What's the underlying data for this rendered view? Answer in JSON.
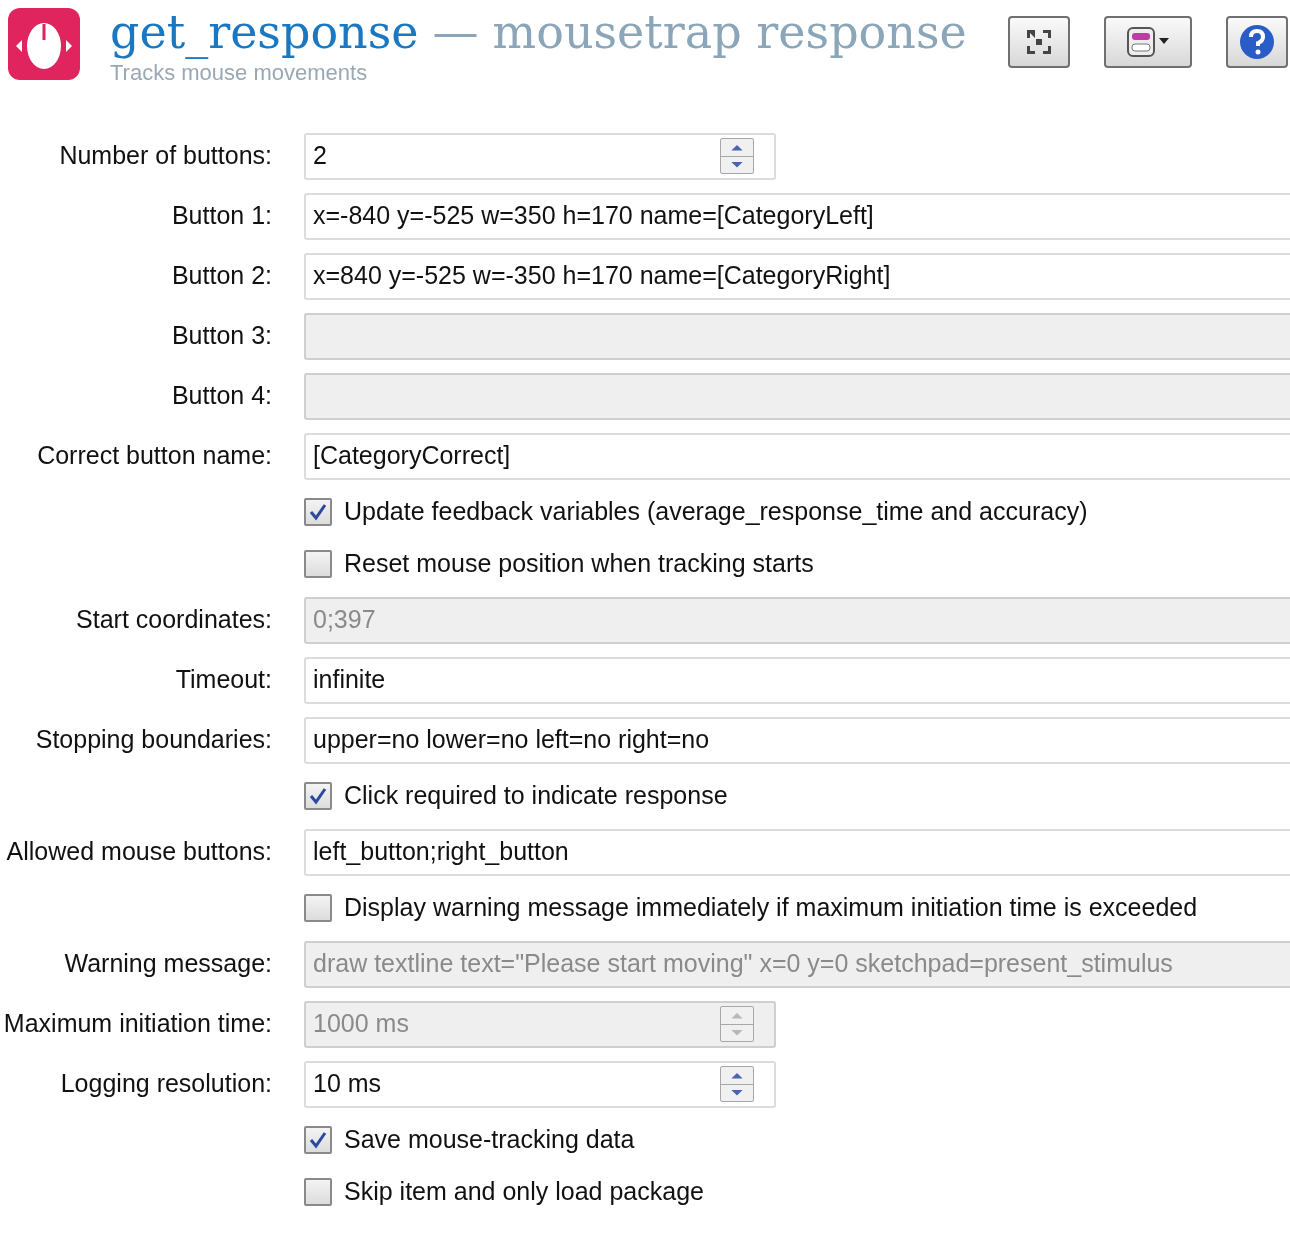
{
  "header": {
    "title": "get_response",
    "separator": "—",
    "subtitle": "mousetrap response",
    "description": "Tracks mouse movements"
  },
  "rows": [
    {
      "kind": "spin",
      "label": "Number of buttons:",
      "value": "2",
      "disabled": false
    },
    {
      "kind": "text",
      "label": "Button 1:",
      "value": "x=-840 y=-525 w=350 h=170 name=[CategoryLeft]",
      "disabled": false
    },
    {
      "kind": "text",
      "label": "Button 2:",
      "value": "x=840 y=-525 w=-350 h=170 name=[CategoryRight]",
      "disabled": false
    },
    {
      "kind": "text",
      "label": "Button 3:",
      "disabled": true
    },
    {
      "kind": "text",
      "label": "Button 4:",
      "disabled": true
    },
    {
      "kind": "text",
      "label": "Correct button name:",
      "value": "[CategoryCorrect]",
      "disabled": false
    },
    {
      "kind": "check",
      "label": "Update feedback variables (average_response_time and accuracy)",
      "checked": true
    },
    {
      "kind": "check",
      "label": "Reset mouse position when tracking starts",
      "checked": false
    },
    {
      "kind": "text",
      "label": "Start coordinates:",
      "value": "0;397",
      "disabled": true
    },
    {
      "kind": "text",
      "label": "Timeout:",
      "value": "infinite",
      "disabled": false
    },
    {
      "kind": "text",
      "label": "Stopping boundaries:",
      "value": "upper=no lower=no left=no right=no",
      "disabled": false
    },
    {
      "kind": "check",
      "label": "Click required to indicate response",
      "checked": true
    },
    {
      "kind": "text",
      "label": "Allowed mouse buttons:",
      "value": "left_button;right_button",
      "disabled": false
    },
    {
      "kind": "check",
      "label": "Display warning message immediately if maximum initiation time is exceeded",
      "checked": false
    },
    {
      "kind": "text",
      "label": "Warning message:",
      "value": "draw textline text=\"Please start moving\" x=0 y=0 sketchpad=present_stimulus",
      "disabled": true
    },
    {
      "kind": "spin",
      "label": "Maximum initiation time:",
      "value": "1000 ms",
      "disabled": true
    },
    {
      "kind": "spin",
      "label": "Logging resolution:",
      "value": "10 ms",
      "disabled": false
    },
    {
      "kind": "check",
      "label": "Save mouse-tracking data",
      "checked": true
    },
    {
      "kind": "check",
      "label": "Skip item and only load package",
      "checked": false
    }
  ]
}
